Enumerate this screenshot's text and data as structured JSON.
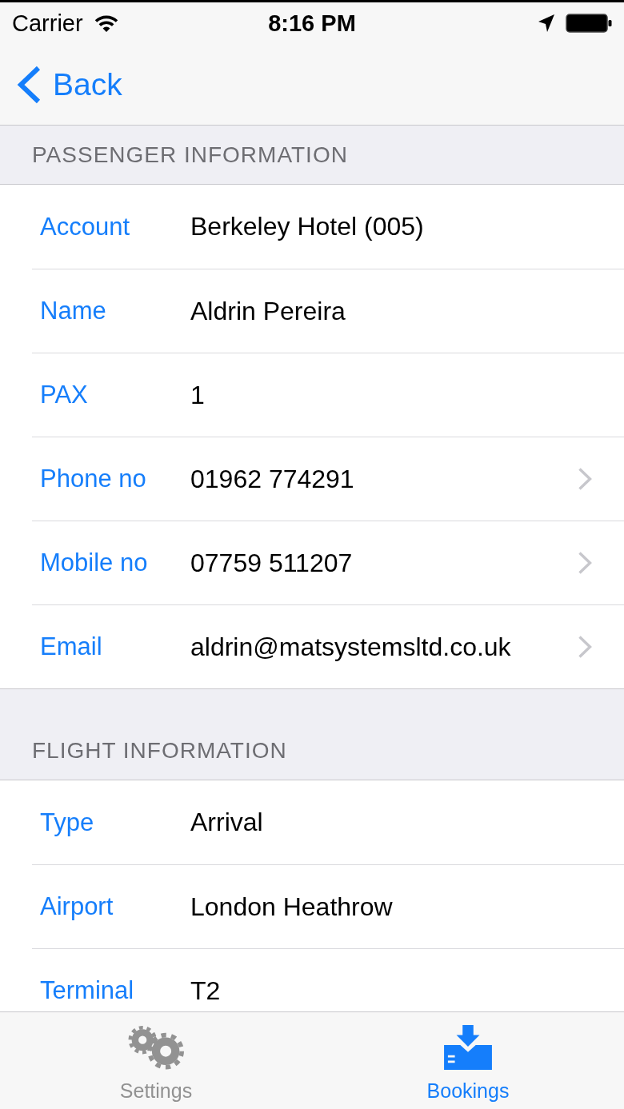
{
  "status_bar": {
    "carrier": "Carrier",
    "time": "8:16 PM"
  },
  "nav_bar": {
    "back_label": "Back"
  },
  "sections": [
    {
      "header": "PASSENGER INFORMATION",
      "rows": [
        {
          "label": "Account",
          "value": "Berkeley Hotel (005)",
          "disclosure": false
        },
        {
          "label": "Name",
          "value": "Aldrin Pereira",
          "disclosure": false
        },
        {
          "label": "PAX",
          "value": "1",
          "disclosure": false
        },
        {
          "label": "Phone no",
          "value": "01962 774291",
          "disclosure": true
        },
        {
          "label": "Mobile no",
          "value": "07759 511207",
          "disclosure": true
        },
        {
          "label": "Email",
          "value": "aldrin@matsystemsltd.co.uk",
          "disclosure": true
        }
      ]
    },
    {
      "header": "FLIGHT INFORMATION",
      "rows": [
        {
          "label": "Type",
          "value": "Arrival",
          "disclosure": false
        },
        {
          "label": "Airport",
          "value": "London Heathrow",
          "disclosure": false
        },
        {
          "label": "Terminal",
          "value": "T2",
          "disclosure": false
        }
      ]
    }
  ],
  "tab_bar": {
    "items": [
      {
        "kind": "settings",
        "label": "Settings",
        "selected": false
      },
      {
        "kind": "bookings",
        "label": "Bookings",
        "selected": true
      }
    ]
  }
}
